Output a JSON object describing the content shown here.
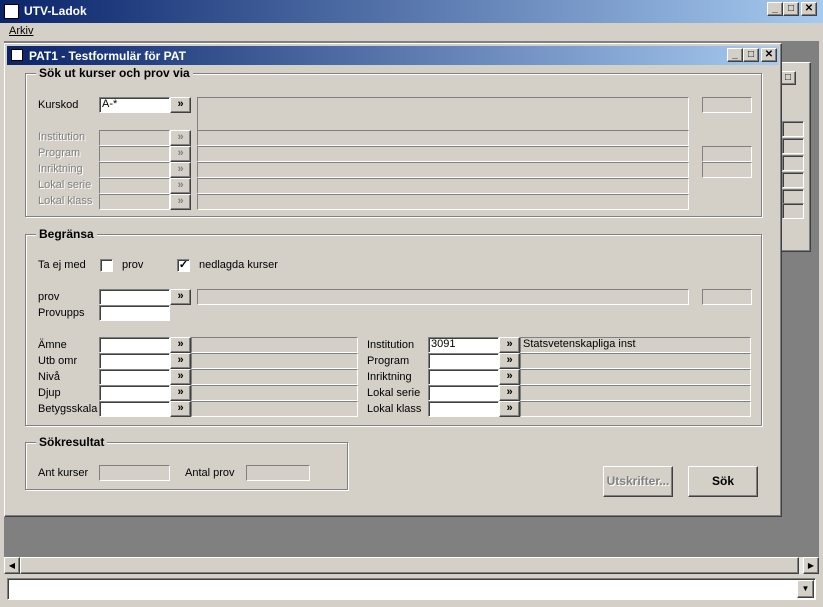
{
  "app": {
    "title": "UTV-Ladok",
    "menu_arkiv": "Arkiv",
    "min": "_",
    "max": "□",
    "close": "✕"
  },
  "window": {
    "title": "PAT1 - Testformulär för PAT",
    "min": "_",
    "max": "□",
    "close": "✕"
  },
  "bg_window": {
    "max": "□"
  },
  "search": {
    "title": "Sök ut kurser och prov via",
    "kurskod_label": "Kurskod",
    "kurskod_value": "A-*",
    "rows": [
      "Institution",
      "Program",
      "Inriktning",
      "Lokal serie",
      "Lokal klass"
    ],
    "arrow": "»"
  },
  "limit": {
    "title": "Begränsa",
    "ta_ej_med": "Ta ej med",
    "prov_check_label": "prov",
    "prov_checked": "",
    "nedlagda_label": "nedlagda kurser",
    "nedlagda_checked": "✓",
    "prov_label": "prov",
    "provupps_label": "Provupps",
    "left_rows": [
      "Ämne",
      "Utb omr",
      "Nivå",
      "Djup",
      "Betygsskala"
    ],
    "right_rows": [
      "Institution",
      "Program",
      "Inriktning",
      "Lokal serie",
      "Lokal klass"
    ],
    "institution_value": "3091",
    "institution_name": "Statsvetenskapliga inst"
  },
  "result": {
    "title": "Sökresultat",
    "ant_kurser": "Ant kurser",
    "antal_prov": "Antal prov"
  },
  "buttons": {
    "utskrifter": "Utskrifter...",
    "sok": "Sök"
  },
  "scroll": {
    "left": "◀",
    "right": "▶",
    "down": "▼"
  }
}
